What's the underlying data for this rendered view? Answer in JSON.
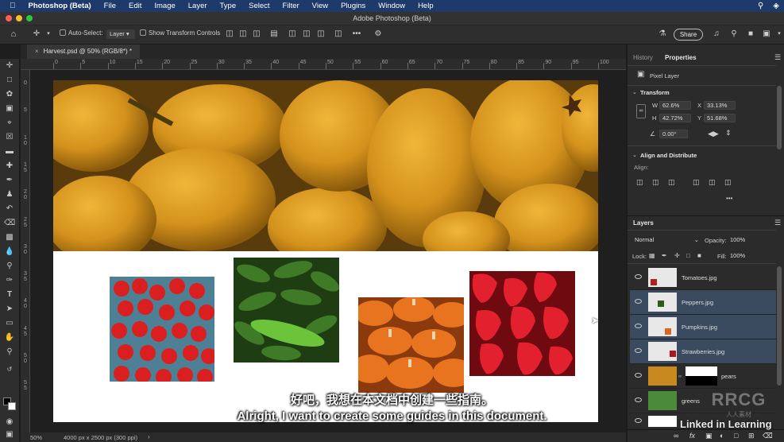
{
  "menubar": {
    "app_name": "Photoshop (Beta)",
    "items": [
      "File",
      "Edit",
      "Image",
      "Layer",
      "Type",
      "Select",
      "Filter",
      "View",
      "Plugins",
      "Window",
      "Help"
    ]
  },
  "window": {
    "title": "Adobe Photoshop (Beta)"
  },
  "options": {
    "auto_select_label": "Auto-Select:",
    "auto_select_value": "Layer",
    "show_transform_label": "Show Transform Controls",
    "share_label": "Share",
    "more_label": "•••"
  },
  "document": {
    "tab_label": "Harvest.psd @ 50% (RGB/8*) *",
    "zoom": "50%",
    "info": "4000 px x 2500 px (300 ppi)"
  },
  "ruler": {
    "h_labels": [
      "0",
      "5",
      "10",
      "15",
      "20",
      "25",
      "30",
      "35",
      "40",
      "45",
      "50",
      "55",
      "60",
      "65",
      "70",
      "75",
      "80",
      "85",
      "90",
      "95",
      "100"
    ],
    "v_labels": [
      "0",
      "5",
      "1\n0",
      "1\n5",
      "2\n0",
      "2\n5",
      "3\n0",
      "3\n5",
      "4\n0",
      "4\n5",
      "5\n0",
      "5\n5"
    ]
  },
  "panels": {
    "tab_history": "History",
    "tab_properties": "Properties",
    "pixel_layer": "Pixel Layer",
    "transform_heading": "Transform",
    "w_label": "W",
    "w_value": "62.6%",
    "x_label": "X",
    "x_value": "33.13%",
    "h_label": "H",
    "h_value": "42.72%",
    "y_label": "Y",
    "y_value": "51.68%",
    "angle_value": "0.00°",
    "align_heading": "Align and Distribute",
    "align_label": "Align:",
    "more_label": "•••",
    "layers_tab": "Layers",
    "blend_mode": "Normal",
    "opacity_label": "Opacity:",
    "opacity_value": "100%",
    "lock_label": "Lock:",
    "fill_label": "Fill:",
    "fill_value": "100%"
  },
  "layers": [
    {
      "name": "Tomatoes.jpg",
      "selected": false
    },
    {
      "name": "Peppers.jpg",
      "selected": true
    },
    {
      "name": "Pumpkins.jpg",
      "selected": true
    },
    {
      "name": "Strawberries.jpg",
      "selected": true
    },
    {
      "name": "pears",
      "selected": false
    },
    {
      "name": "greens",
      "selected": false
    }
  ],
  "subtitles": {
    "chinese": "好吧，我想在本文档中创建一些指南。",
    "english": "Alright, I want to create some guides in this document."
  },
  "watermarks": {
    "linkedin": "Linked in Learning",
    "rrcg": "RRCG",
    "rrcg_sub": "人人素材"
  },
  "colors": {
    "menubar": "#1d3a6b",
    "selection": "#3a4a5f",
    "accent": "#4a90e2"
  }
}
